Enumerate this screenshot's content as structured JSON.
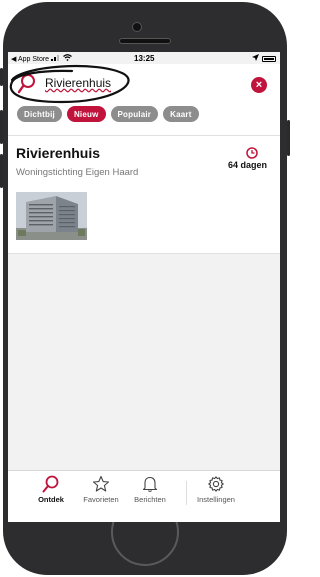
{
  "status_bar": {
    "back_app": "◀ App Store",
    "time": "13:25"
  },
  "search": {
    "query": "Rivierenhuis",
    "close_symbol": "×"
  },
  "filters": [
    {
      "label": "Dichtbij",
      "active": false
    },
    {
      "label": "Nieuw",
      "active": true
    },
    {
      "label": "Populair",
      "active": false
    },
    {
      "label": "Kaart",
      "active": false
    }
  ],
  "result": {
    "title": "Rivierenhuis",
    "subtitle": "Woningstichting Eigen Haard",
    "days_label": "64 dagen"
  },
  "tabbar": {
    "items": [
      {
        "label": "Ontdek",
        "icon": "search-icon",
        "active": true
      },
      {
        "label": "Favorieten",
        "icon": "star-icon",
        "active": false
      },
      {
        "label": "Berichten",
        "icon": "bell-icon",
        "active": false
      },
      {
        "label": "Instellingen",
        "icon": "gear-icon",
        "active": false
      }
    ]
  },
  "colors": {
    "accent": "#c0143c",
    "chip_inactive": "#8d8d8d",
    "frame": "#2d2d2f"
  }
}
